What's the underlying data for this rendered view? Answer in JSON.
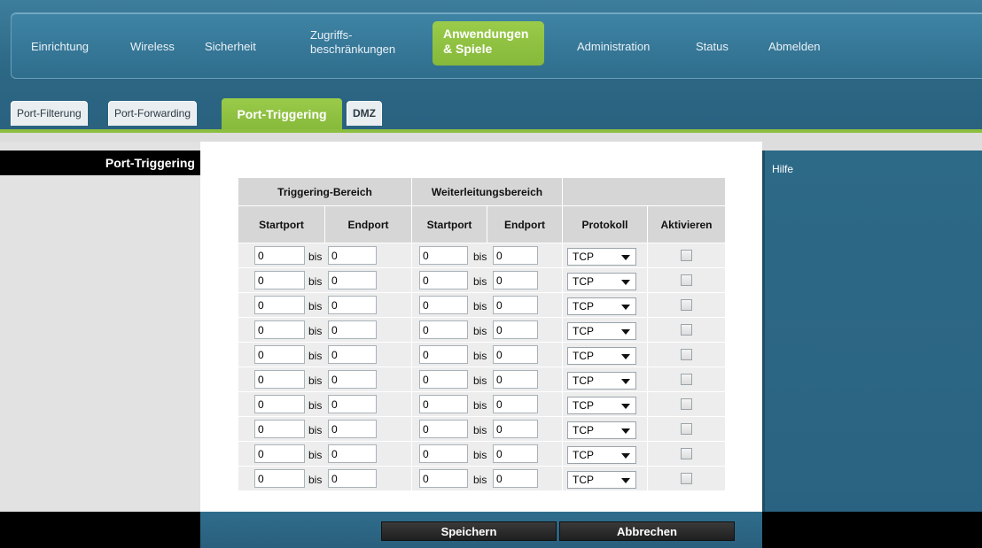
{
  "nav": {
    "items": [
      "Einrichtung",
      "Wireless",
      "Sicherheit"
    ],
    "access_line1": "Zugriffs-",
    "access_line2": "beschränkungen",
    "active_line1": "Anwendungen",
    "active_line2": "& Spiele",
    "items_after": [
      "Administration",
      "Status",
      "Abmelden"
    ]
  },
  "tabs": {
    "items": [
      "Port-Filterung",
      "Port-Forwarding"
    ],
    "active": "Port-Triggering",
    "after": "DMZ"
  },
  "sidebar": {
    "title": "Port-Triggering"
  },
  "help": {
    "label": "Hilfe"
  },
  "table": {
    "group_headers": [
      "Triggering-Bereich",
      "Weiterleitungsbereich",
      ""
    ],
    "columns": [
      "Startport",
      "Endport",
      "Startport",
      "Endport",
      "Protokoll",
      "Aktivieren"
    ],
    "range_separator": "bis",
    "rows": [
      {
        "trig_start": "0",
        "trig_end": "0",
        "fwd_start": "0",
        "fwd_end": "0",
        "protocol": "TCP",
        "enabled": false
      },
      {
        "trig_start": "0",
        "trig_end": "0",
        "fwd_start": "0",
        "fwd_end": "0",
        "protocol": "TCP",
        "enabled": false
      },
      {
        "trig_start": "0",
        "trig_end": "0",
        "fwd_start": "0",
        "fwd_end": "0",
        "protocol": "TCP",
        "enabled": false
      },
      {
        "trig_start": "0",
        "trig_end": "0",
        "fwd_start": "0",
        "fwd_end": "0",
        "protocol": "TCP",
        "enabled": false
      },
      {
        "trig_start": "0",
        "trig_end": "0",
        "fwd_start": "0",
        "fwd_end": "0",
        "protocol": "TCP",
        "enabled": false
      },
      {
        "trig_start": "0",
        "trig_end": "0",
        "fwd_start": "0",
        "fwd_end": "0",
        "protocol": "TCP",
        "enabled": false
      },
      {
        "trig_start": "0",
        "trig_end": "0",
        "fwd_start": "0",
        "fwd_end": "0",
        "protocol": "TCP",
        "enabled": false
      },
      {
        "trig_start": "0",
        "trig_end": "0",
        "fwd_start": "0",
        "fwd_end": "0",
        "protocol": "TCP",
        "enabled": false
      },
      {
        "trig_start": "0",
        "trig_end": "0",
        "fwd_start": "0",
        "fwd_end": "0",
        "protocol": "TCP",
        "enabled": false
      },
      {
        "trig_start": "0",
        "trig_end": "0",
        "fwd_start": "0",
        "fwd_end": "0",
        "protocol": "TCP",
        "enabled": false
      }
    ]
  },
  "buttons": {
    "save": "Speichern",
    "cancel": "Abbrechen"
  },
  "colors": {
    "brand_blue": "#2c6784",
    "accent_green": "#8cbf3f"
  }
}
